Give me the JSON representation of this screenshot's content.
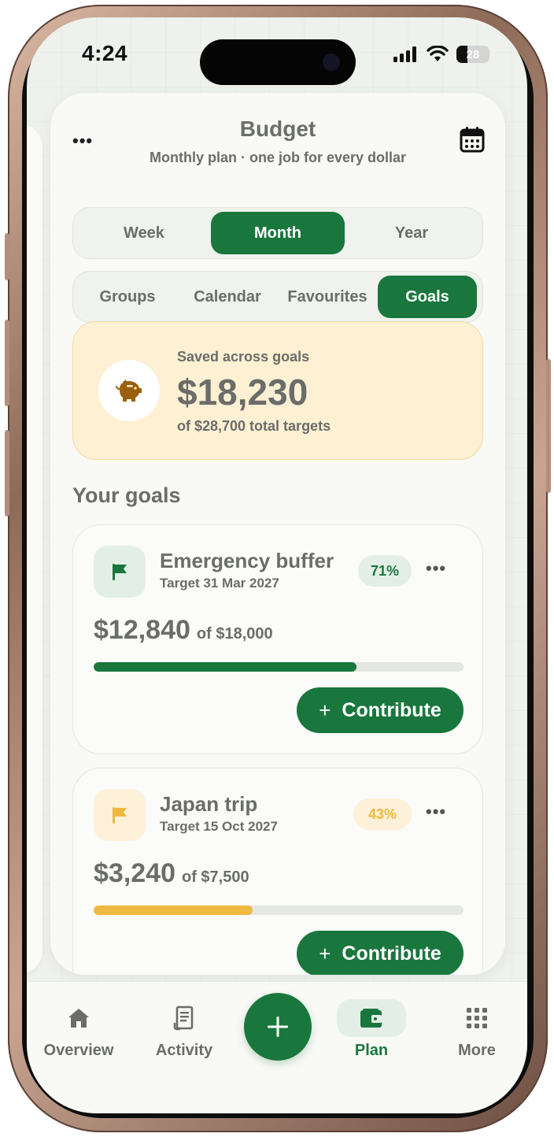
{
  "status_bar": {
    "time": "4:24",
    "battery": "28"
  },
  "header": {
    "title": "Budget",
    "subtitle": "Monthly plan · one job for every dollar",
    "menu_icon": "more-horizontal-icon",
    "calendar_icon": "calendar-icon"
  },
  "period_tabs": [
    {
      "label": "Week",
      "active": false
    },
    {
      "label": "Month",
      "active": true
    },
    {
      "label": "Year",
      "active": false
    }
  ],
  "view_tabs": [
    {
      "label": "Groups",
      "active": false
    },
    {
      "label": "Calendar",
      "active": false
    },
    {
      "label": "Favourites",
      "active": false
    },
    {
      "label": "Goals",
      "active": true
    }
  ],
  "summary": {
    "label": "Saved across goals",
    "amount": "$18,230",
    "of_total": "of $28,700 total targets",
    "icon": "piggy-bank-icon"
  },
  "section_title": "Your goals",
  "goals": [
    {
      "name": "Emergency buffer",
      "target": "Target 31 Mar 2027",
      "percent_label": "71%",
      "progress": 0.71,
      "saved": "$12,840",
      "of": "of $18,000",
      "button": "Contribute",
      "icon": "flag-icon",
      "accent": "#19773d",
      "accent_bg": "#e3efe6"
    },
    {
      "name": "Japan trip",
      "target": "Target 15 Oct 2027",
      "percent_label": "43%",
      "progress": 0.43,
      "saved": "$3,240",
      "of": "of $7,500",
      "button": "Contribute",
      "icon": "flag-icon",
      "accent": "#efb93f",
      "accent_bg": "#fdf1da"
    }
  ],
  "tabbar": {
    "items": [
      {
        "label": "Overview",
        "icon": "home-icon",
        "active": false
      },
      {
        "label": "Activity",
        "icon": "receipt-icon",
        "active": false
      },
      {
        "label": "Plan",
        "icon": "wallet-icon",
        "active": true
      },
      {
        "label": "More",
        "icon": "grid-icon",
        "active": false
      }
    ],
    "fab_icon": "plus-icon"
  },
  "colors": {
    "primary": "#19773d",
    "text_muted": "#6a6d69",
    "summary_bg": "#fdf0d3"
  }
}
